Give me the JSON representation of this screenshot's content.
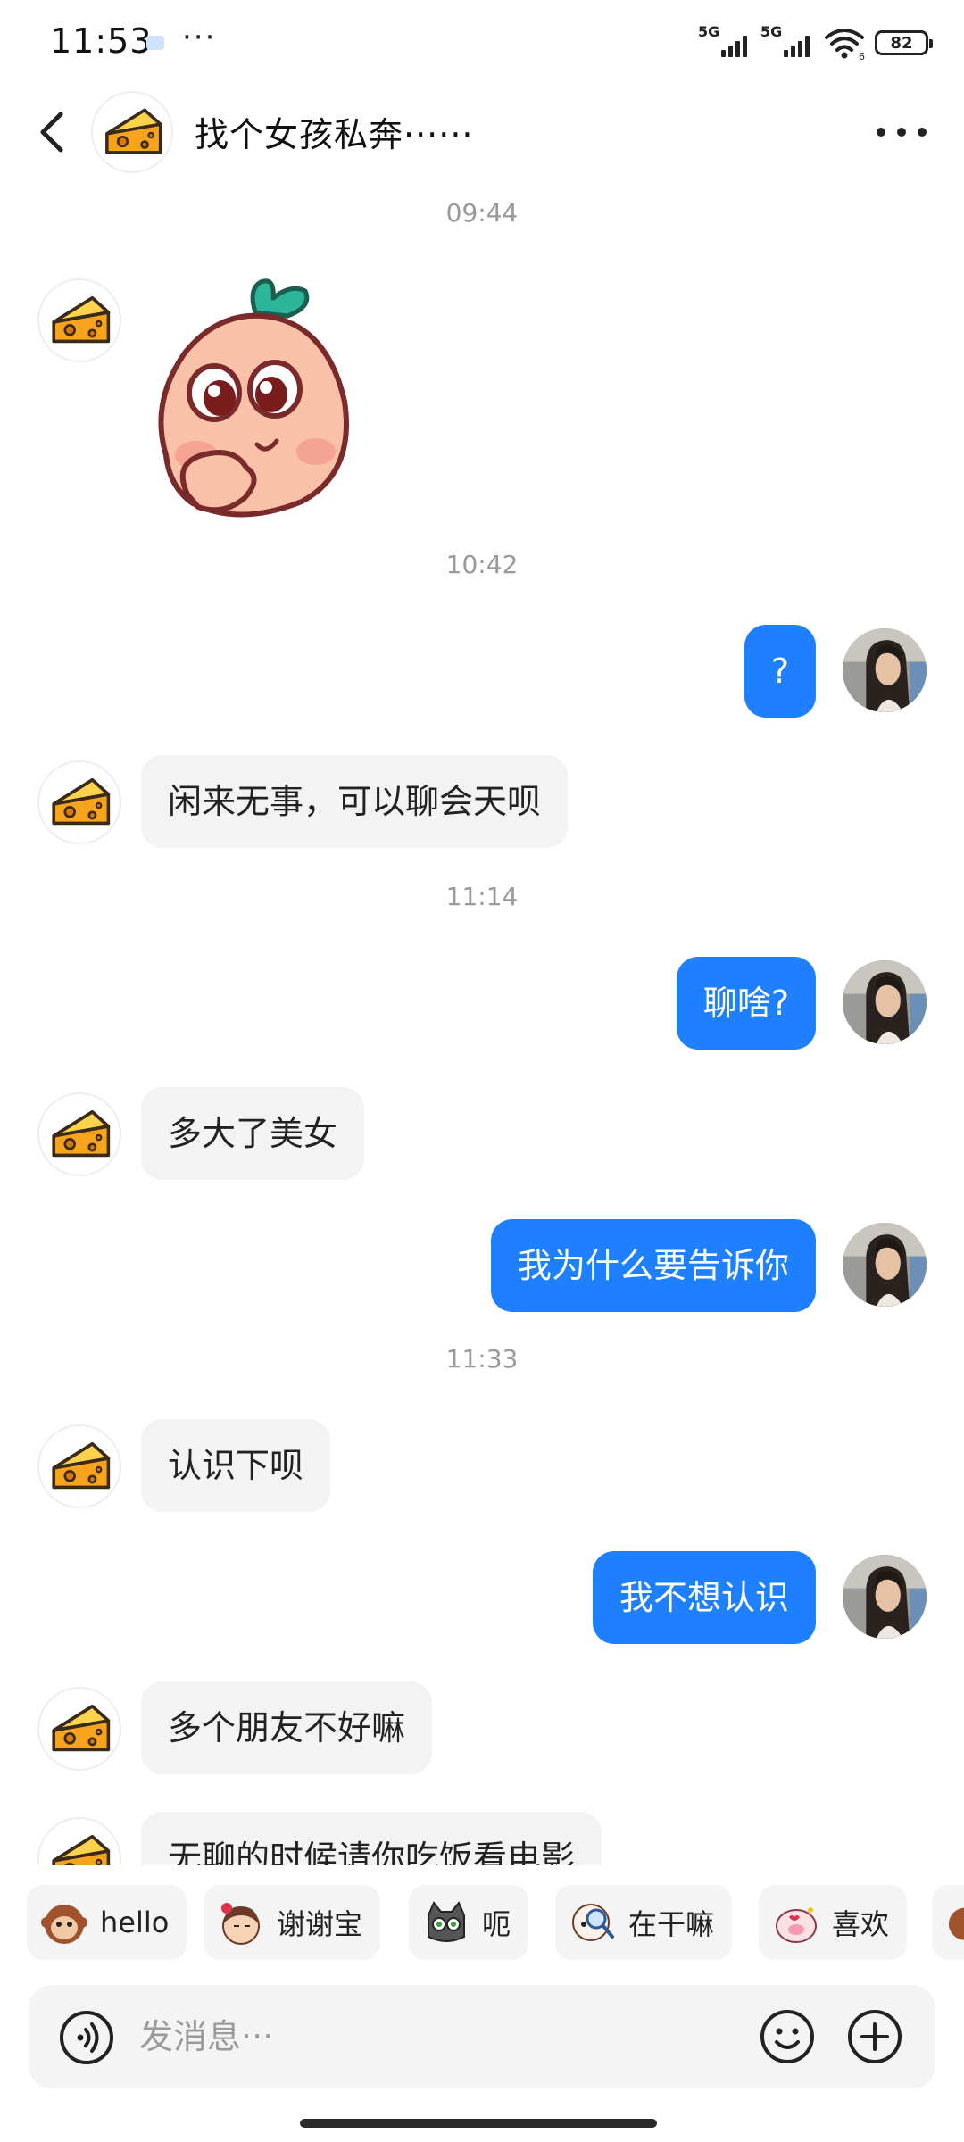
{
  "status_bar": {
    "time": "11:53",
    "overflow": "···",
    "signal_1": "5G",
    "signal_2": "5G",
    "wifi_badge": "6",
    "battery": "82"
  },
  "header": {
    "title": "找个女孩私奔······",
    "back_icon": "chevron-left-icon",
    "more_icon": "more-dots-icon"
  },
  "messages": {
    "t1": "09:44",
    "t2": "10:42",
    "m1": "?",
    "m2": "闲来无事，可以聊会天呗",
    "t3": "11:14",
    "m3": "聊啥?",
    "m4": "多大了美女",
    "m5": "我为什么要告诉你",
    "t4": "11:33",
    "m6": "认识下呗",
    "m7": "我不想认识",
    "m8": "多个朋友不好嘛",
    "m9": "无聊的时候请你吃饭看电影"
  },
  "quick_replies": [
    "hello",
    "谢谢宝",
    "呃",
    "在干嘛",
    "喜欢"
  ],
  "input": {
    "placeholder": "发消息···",
    "voice_icon": "voice-icon",
    "emoji_icon": "emoji-icon",
    "plus_icon": "plus-icon"
  },
  "colors": {
    "outgoing_bubble": "#1e80ff",
    "incoming_bubble": "#f3f3f3",
    "timestamp": "#999999"
  }
}
